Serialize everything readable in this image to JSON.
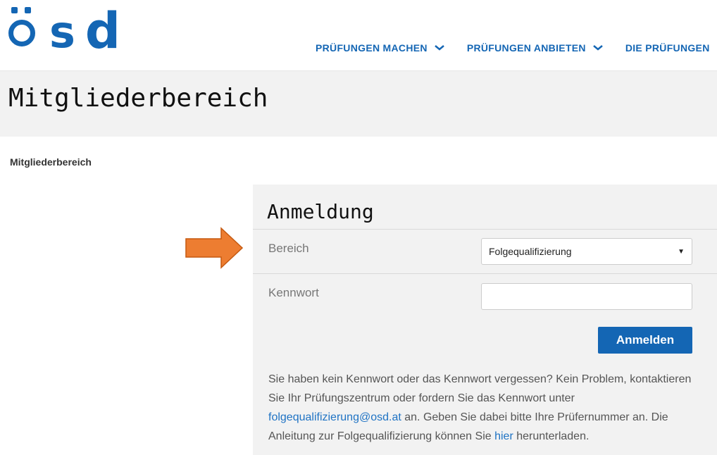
{
  "brand": {
    "logo_text": "ösd",
    "color": "#1466b4"
  },
  "nav": {
    "items": [
      {
        "label": "PRÜFUNGEN MACHEN",
        "icon": "chevron-down-icon"
      },
      {
        "label": "PRÜFUNGEN ANBIETEN",
        "icon": "chevron-down-icon"
      },
      {
        "label": "DIE PRÜFUNGEN"
      }
    ]
  },
  "page": {
    "title": "Mitgliederbereich",
    "breadcrumb": "Mitgliederbereich"
  },
  "annotation": {
    "arrow_color": "#ed7d31",
    "icon": "arrow-right-icon"
  },
  "login": {
    "heading": "Anmeldung",
    "area_label": "Bereich",
    "area_value": "Folgequalifizierung",
    "password_label": "Kennwort",
    "password_value": "",
    "submit_label": "Anmelden",
    "info": {
      "text1": "Sie haben kein Kennwort oder das Kennwort vergessen? Kein Problem, kontaktieren Sie Ihr Prüfungszentrum oder fordern Sie das Kennwort unter ",
      "email_link": "folgequalifizierung@osd.at",
      "text2": " an. Geben Sie dabei bitte Ihre Prüfernummer an. Die Anleitung zur Folgequalifizierung können Sie ",
      "here_link": "hier",
      "text3": " herunterladen."
    }
  }
}
